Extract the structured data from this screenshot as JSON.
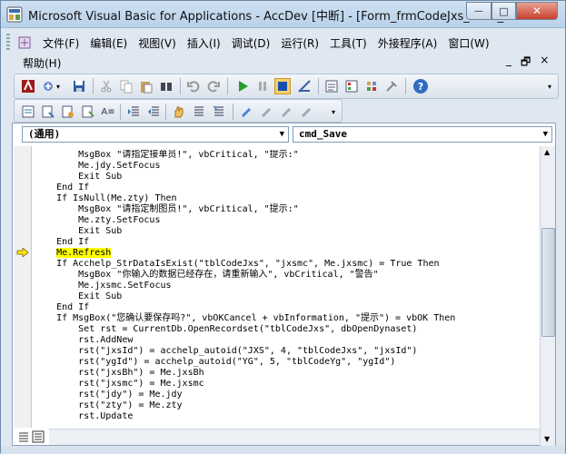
{
  "window": {
    "title": "Microsoft Visual Basic for Applications - AccDev [中断] - [Form_frmCodeJxs_child_...",
    "minimize": "—",
    "maximize": "□",
    "close": "✕"
  },
  "menu": {
    "row1": [
      "文件(F)",
      "编辑(E)",
      "视图(V)",
      "插入(I)",
      "调试(D)",
      "运行(R)",
      "工具(T)",
      "外接程序(A)",
      "窗口(W)"
    ],
    "row2": [
      "帮助(H)"
    ],
    "mdi": [
      "_",
      "🗗",
      "×"
    ]
  },
  "code_window": {
    "object_combo": "(通用)",
    "procedure_combo": "cmd_Save",
    "lines": [
      "        MsgBox \"请指定接单员!\", vbCritical, \"提示:\"",
      "        Me.jdy.SetFocus",
      "        Exit Sub",
      "    End If",
      "    If IsNull(Me.zty) Then",
      "        MsgBox \"请指定制图员!\", vbCritical, \"提示:\"",
      "        Me.zty.SetFocus",
      "        Exit Sub",
      "    End If",
      "    Me.Refresh",
      "    If Acchelp_StrDataIsExist(\"tblCodeJxs\", \"jxsmc\", Me.jxsmc) = True Then",
      "        MsgBox \"你输入的数据已经存在，请重新输入\", vbCritical, \"警告\"",
      "        Me.jxsmc.SetFocus",
      "        Exit Sub",
      "    End If",
      "    If MsgBox(\"您确认要保存吗?\", vbOKCancel + vbInformation, \"提示\") = vbOK Then",
      "        Set rst = CurrentDb.OpenRecordset(\"tblCodeJxs\", dbOpenDynaset)",
      "        rst.AddNew",
      "        rst(\"jxsId\") = acchelp_autoid(\"JXS\", 4, \"tblCodeJxs\", \"jxsId\")",
      "        rst(\"ygId\") = acchelp_autoid(\"YG\", 5, \"tblCodeYg\", \"ygId\")",
      "        rst(\"jxsBh\") = Me.jxsBh",
      "        rst(\"jxsmc\") = Me.jxsmc",
      "        rst(\"jdy\") = Me.jdy",
      "        rst(\"zty\") = Me.zty",
      "        rst.Update"
    ],
    "current_line_index": 9
  }
}
